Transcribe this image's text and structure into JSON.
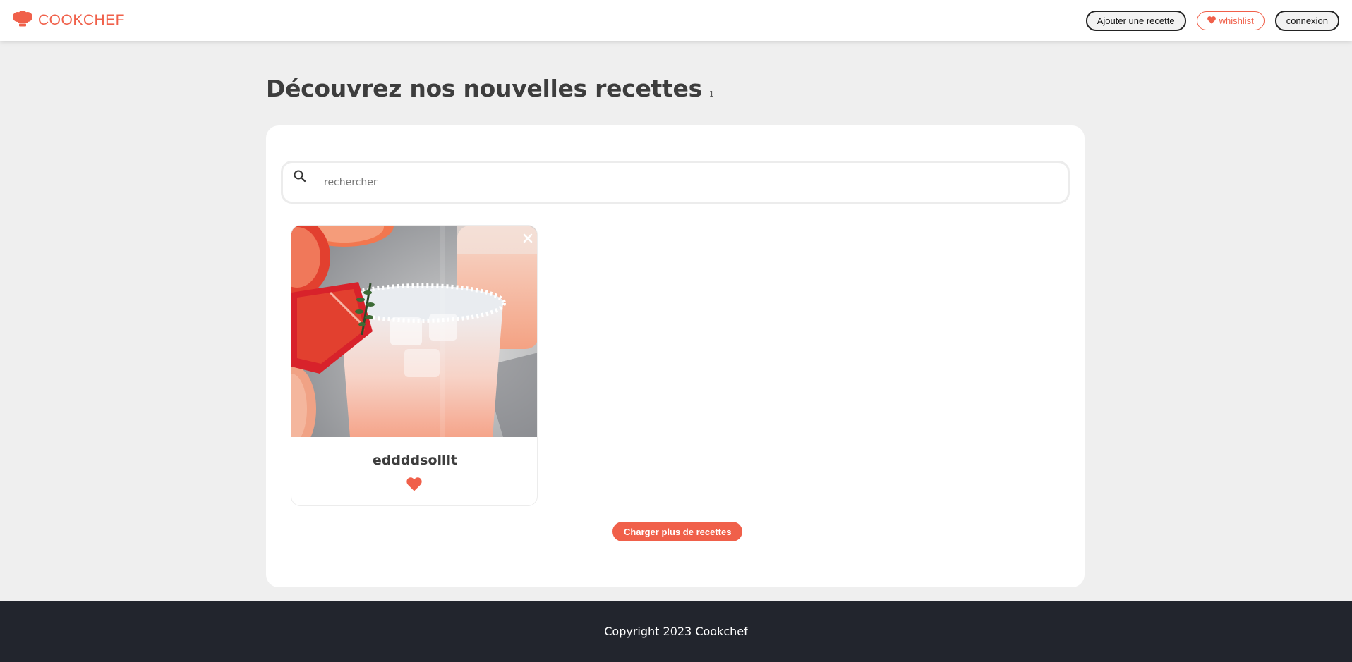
{
  "header": {
    "logo_text": "COOKCHEF",
    "logo_icon": "chef-hat-icon",
    "nav": {
      "add_recipe_label": "Ajouter une recette",
      "wishlist_label": "whishlist",
      "wishlist_icon": "heart-icon",
      "login_label": "connexion"
    }
  },
  "main": {
    "title": "Découvrez nos nouvelles recettes",
    "title_count": "1",
    "search": {
      "placeholder": "rechercher",
      "value": "",
      "icon": "search-icon"
    },
    "recipes": [
      {
        "title": "eddddsolllt",
        "image_subject": "grapefruit cocktail with salted rim and thyme",
        "favorite": true
      }
    ],
    "load_more_label": "Charger plus de recettes"
  },
  "footer": {
    "copyright": "Copyright 2023 Cookchef"
  },
  "colors": {
    "accent": "#f0604a",
    "page_background": "#efefef",
    "panel_background": "#ffffff",
    "footer_background": "#22252d",
    "title_text": "#3d3d3d"
  }
}
